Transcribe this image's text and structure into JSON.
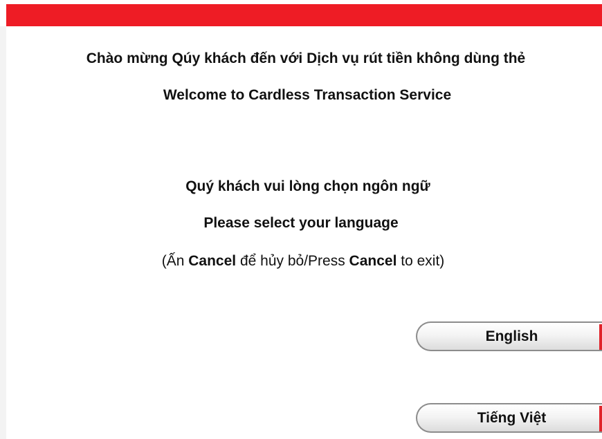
{
  "header": {
    "accent_color": "#ee1c25"
  },
  "welcome": {
    "vi": "Chào mừng Qúy khách đến với Dịch vụ rút tiền không dùng thẻ",
    "en": "Welcome to Cardless Transaction Service"
  },
  "prompt": {
    "vi": "Quý khách vui lòng chọn ngôn ngữ",
    "en": "Please select your language"
  },
  "hint": {
    "open": "(Ấn ",
    "cancel_1": "Cancel",
    "middle": " để hủy bỏ/Press ",
    "cancel_2": "Cancel",
    "close": " to exit)"
  },
  "buttons": {
    "english": "English",
    "vietnamese": "Tiếng Việt",
    "accent_color": "#e0242b"
  }
}
